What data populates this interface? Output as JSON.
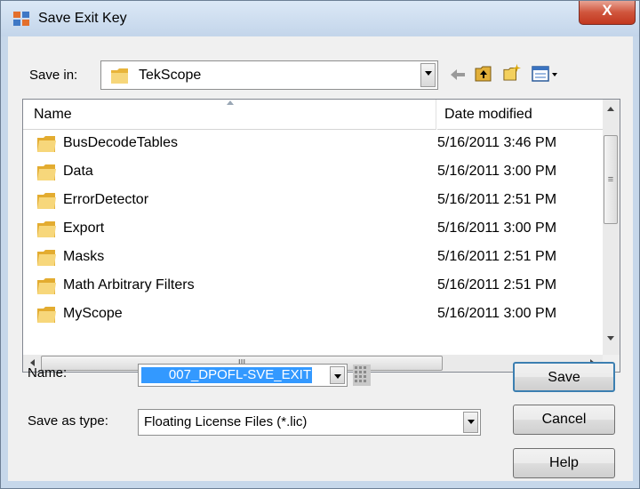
{
  "window": {
    "title": "Save Exit Key",
    "close_label": "X"
  },
  "save_in": {
    "label": "Save in:",
    "folder": "TekScope"
  },
  "file_list": {
    "columns": [
      "Name",
      "Date modified"
    ],
    "items": [
      {
        "name": "BusDecodeTables",
        "date": "5/16/2011 3:46 PM"
      },
      {
        "name": "Data",
        "date": "5/16/2011 3:00 PM"
      },
      {
        "name": "ErrorDetector",
        "date": "5/16/2011 2:51 PM"
      },
      {
        "name": "Export",
        "date": "5/16/2011 3:00 PM"
      },
      {
        "name": "Masks",
        "date": "5/16/2011 2:51 PM"
      },
      {
        "name": "Math Arbitrary Filters",
        "date": "5/16/2011 2:51 PM"
      },
      {
        "name": "MyScope",
        "date": "5/16/2011 3:00 PM"
      }
    ],
    "hscroll_grip": "III",
    "vscroll_grip": "≡"
  },
  "name_field": {
    "label": "Name:",
    "value": "007_DPOFL-SVE_EXIT"
  },
  "save_as_type": {
    "label": "Save as type:",
    "value": "Floating License Files (*.lic)"
  },
  "buttons": {
    "save": "Save",
    "cancel": "Cancel",
    "help": "Help"
  }
}
